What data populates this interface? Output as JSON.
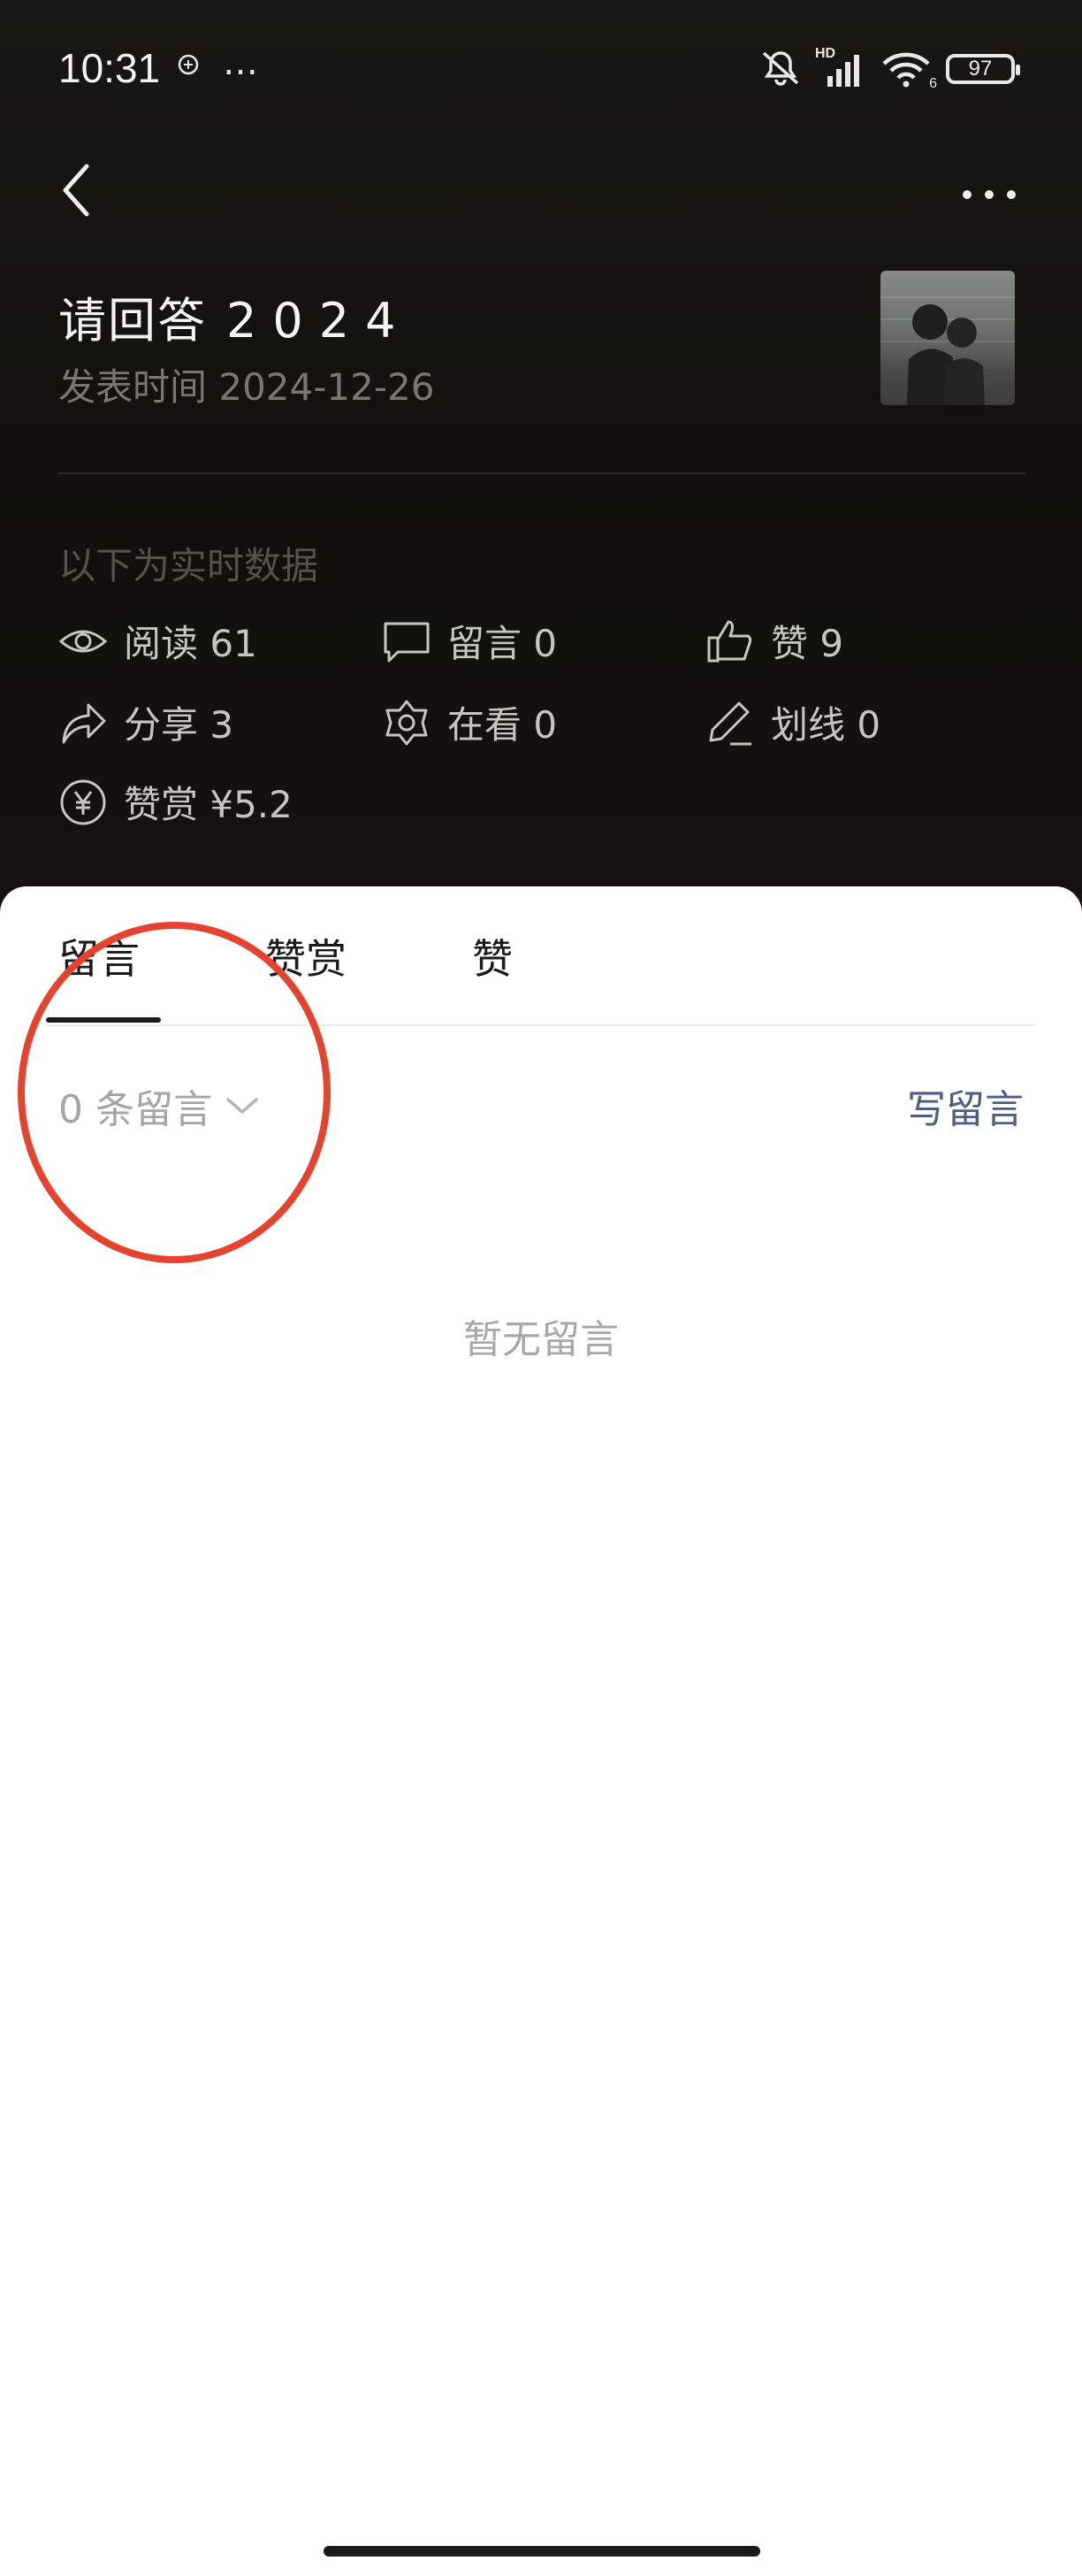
{
  "status_bar": {
    "time": "10:31",
    "notification_icon": "…",
    "battery": "97",
    "hd_label": "HD",
    "signal_sub": "6"
  },
  "header": {
    "back_icon": "chevron-left-icon",
    "more_icon": "more-horizontal-icon"
  },
  "article": {
    "title": "请回答",
    "title_year": "2024",
    "publish_time": "发表时间 2024-12-26"
  },
  "stats": {
    "hint": "以下为实时数据",
    "items": [
      {
        "icon": "eye-icon",
        "label": "阅读 61"
      },
      {
        "icon": "comment-icon",
        "label": "留言 0"
      },
      {
        "icon": "thumbs-up-icon",
        "label": "赞 9"
      },
      {
        "icon": "share-icon",
        "label": "分享 3"
      },
      {
        "icon": "watching-icon",
        "label": "在看 0"
      },
      {
        "icon": "highlight-pen-icon",
        "label": "划线 0"
      },
      {
        "icon": "yen-coin-icon",
        "label": "赞赏 ¥5.2"
      }
    ]
  },
  "tabs": [
    {
      "label": "留言",
      "active": true
    },
    {
      "label": "赞赏",
      "active": false
    },
    {
      "label": "赞",
      "active": false
    }
  ],
  "comments": {
    "count_label": "0 条留言",
    "write_label": "写留言",
    "empty_label": "暂无留言"
  },
  "colors": {
    "header_bg": "#16110e",
    "link": "#4b5f83",
    "annotation": "#e3432f"
  }
}
